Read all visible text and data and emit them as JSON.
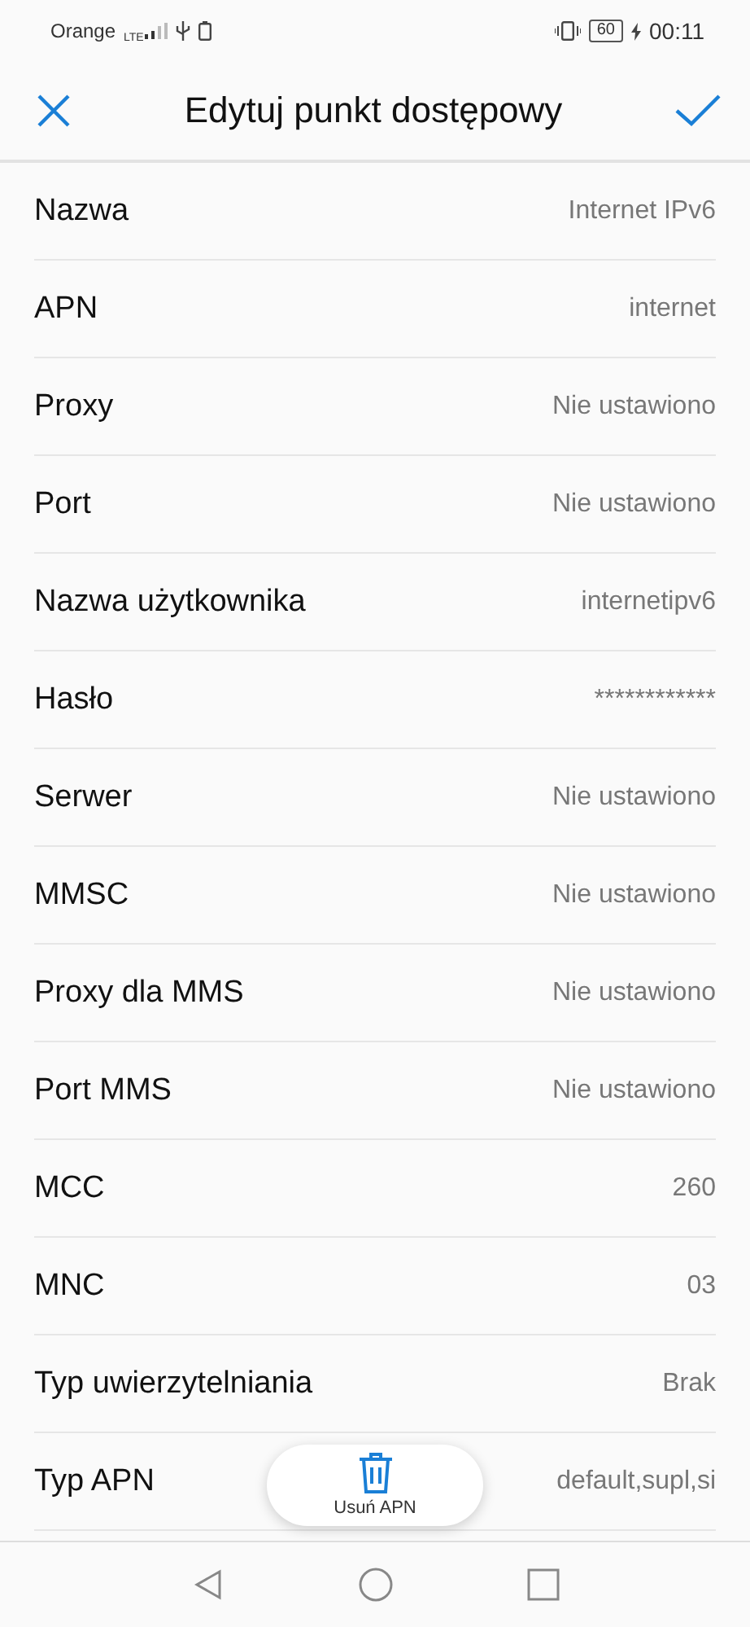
{
  "status_bar": {
    "carrier": "Orange",
    "network": "LTE",
    "battery": "60",
    "time": "00:11"
  },
  "header": {
    "title": "Edytuj punkt dostępowy"
  },
  "rows": [
    {
      "label": "Nazwa",
      "value": "Internet IPv6"
    },
    {
      "label": "APN",
      "value": "internet"
    },
    {
      "label": "Proxy",
      "value": "Nie ustawiono"
    },
    {
      "label": "Port",
      "value": "Nie ustawiono"
    },
    {
      "label": "Nazwa użytkownika",
      "value": "internetipv6"
    },
    {
      "label": "Hasło",
      "value": "************"
    },
    {
      "label": "Serwer",
      "value": "Nie ustawiono"
    },
    {
      "label": "MMSC",
      "value": "Nie ustawiono"
    },
    {
      "label": "Proxy dla MMS",
      "value": "Nie ustawiono"
    },
    {
      "label": "Port MMS",
      "value": "Nie ustawiono"
    },
    {
      "label": "MCC",
      "value": "260"
    },
    {
      "label": "MNC",
      "value": "03"
    },
    {
      "label": "Typ uwierzytelniania",
      "value": "Brak"
    },
    {
      "label": "Typ APN",
      "value": "default,supl,si"
    }
  ],
  "delete_button": {
    "label": "Usuń APN"
  }
}
